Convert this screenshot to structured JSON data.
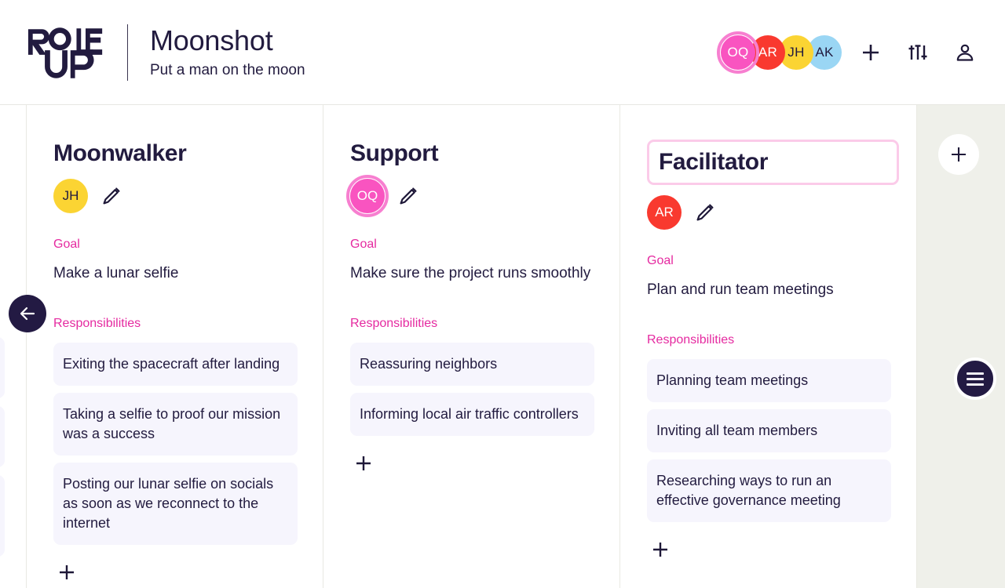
{
  "app": {
    "logo_text_line1": "ROLE",
    "logo_text_line2": "UP",
    "accent_pink": "#e52aa0",
    "accent_pink_light": "#fbcbe9",
    "dark": "#221b3f",
    "card_bg": "#f6f5fd",
    "board_right_bg": "#eff0ea"
  },
  "header": {
    "project_title": "Moonshot",
    "project_subtitle": "Put a man on the moon",
    "members": [
      {
        "initials": "OQ",
        "bg": "#f954c0",
        "fg": "#ffffff",
        "ringed": true
      },
      {
        "initials": "AR",
        "bg": "#f9392f",
        "fg": "#ffffff",
        "ringed": false
      },
      {
        "initials": "JH",
        "bg": "#fbd433",
        "fg": "#221b3f",
        "ringed": false
      },
      {
        "initials": "AK",
        "bg": "#9ad6f4",
        "fg": "#221b3f",
        "ringed": false
      }
    ],
    "add_member_label": "+",
    "settings_icon": "sliders-icon",
    "account_icon": "person-icon"
  },
  "board": {
    "back_icon": "arrow-left-icon",
    "add_column_icon": "plus-icon",
    "menu_icon": "hamburger-menu-icon",
    "labels": {
      "goal": "Goal",
      "responsibilities": "Responsibilities",
      "add_responsibility": "+",
      "edit": "pencil-icon"
    },
    "columns": [
      {
        "title": "Moonwalker",
        "title_editing": false,
        "assignee": {
          "initials": "JH",
          "bg": "#fbd433",
          "fg": "#221b3f",
          "ringed": false
        },
        "goal": "Make a lunar selfie",
        "responsibilities": [
          "Exiting the spacecraft after landing",
          "Taking a selfie to proof our mission was a success",
          "Posting our lunar selfie on socials as soon as we reconnect to the internet"
        ]
      },
      {
        "title": "Support",
        "title_editing": false,
        "assignee": {
          "initials": "OQ",
          "bg": "#f954c0",
          "fg": "#ffffff",
          "ringed": true
        },
        "goal": "Make sure the project runs smoothly",
        "responsibilities": [
          "Reassuring neighbors",
          "Informing local air traffic controllers"
        ]
      },
      {
        "title": "Facilitator",
        "title_editing": true,
        "assignee": {
          "initials": "AR",
          "bg": "#f9392f",
          "fg": "#ffffff",
          "ringed": false
        },
        "goal": "Plan and run team meetings",
        "responsibilities": [
          "Planning team meetings",
          "Inviting all team members",
          "Researching ways to run an effective governance meeting"
        ]
      }
    ]
  }
}
